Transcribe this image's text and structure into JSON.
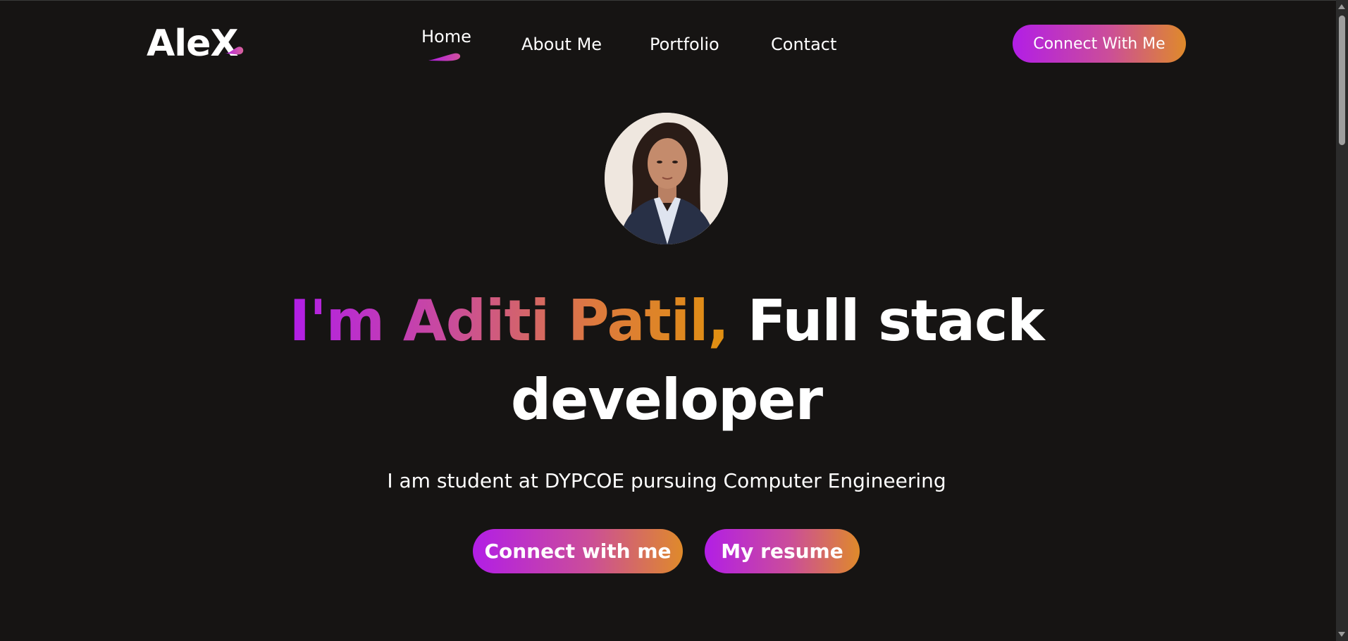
{
  "header": {
    "logo_text": "AleX",
    "nav": [
      {
        "label": "Home",
        "active": true
      },
      {
        "label": "About Me",
        "active": false
      },
      {
        "label": "Portfolio",
        "active": false
      },
      {
        "label": "Contact",
        "active": false
      }
    ],
    "cta_label": "Connect With Me"
  },
  "hero": {
    "title_gradient": "I'm Aditi Patil,",
    "title_rest_line1": "Full stack",
    "title_line2": "developer",
    "subtitle": "I am student at DYPCOE pursuing Computer Engineering",
    "primary_button": "Connect with me",
    "secondary_button": "My resume",
    "avatar_icon": "profile-photo"
  },
  "colors": {
    "background": "#161413",
    "gradient_start": "#b21ee6",
    "gradient_mid": "#cb4d9a",
    "gradient_end": "#df8a2a",
    "text": "#ffffff"
  }
}
